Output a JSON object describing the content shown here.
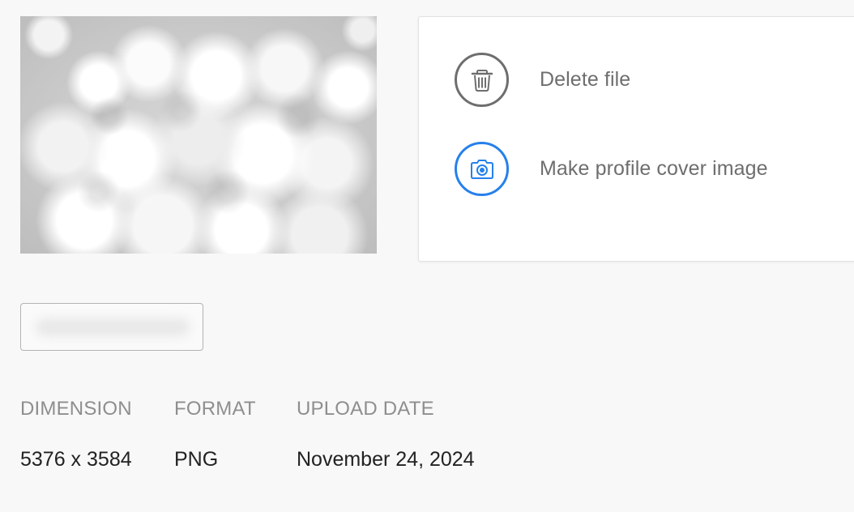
{
  "actions": {
    "delete_label": "Delete file",
    "cover_label": "Make profile cover image",
    "delete_icon": "trash-icon",
    "cover_icon": "camera-icon"
  },
  "colors": {
    "accent": "#2680eb",
    "icon_gray": "#6e6e6e",
    "label_gray": "#8e8e8e"
  },
  "metadata": {
    "dimension": {
      "label": "DIMENSION",
      "value": "5376 x 3584"
    },
    "format": {
      "label": "FORMAT",
      "value": "PNG"
    },
    "upload_date": {
      "label": "UPLOAD DATE",
      "value": "November 24, 2024"
    }
  }
}
